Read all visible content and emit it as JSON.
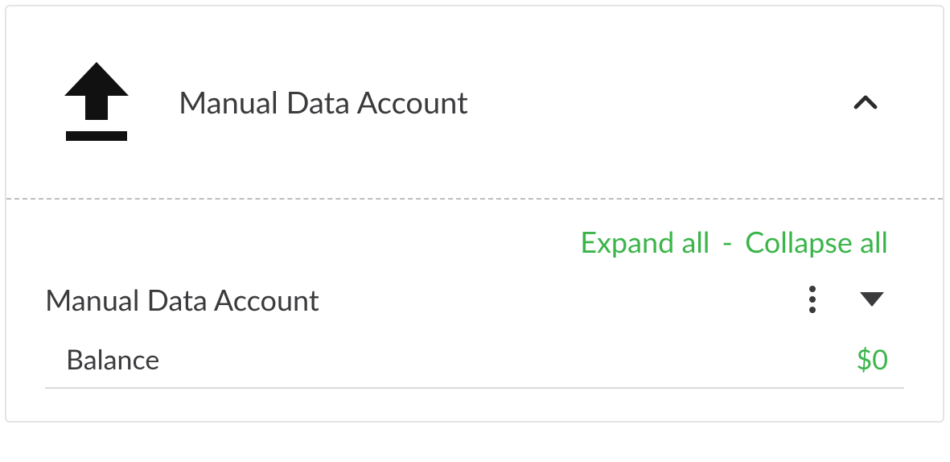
{
  "header": {
    "title": "Manual Data Account"
  },
  "controls": {
    "expand_all": "Expand all",
    "collapse_all": "Collapse all",
    "separator": "-"
  },
  "account": {
    "name": "Manual Data Account",
    "balance_label": "Balance",
    "balance_value": "$0"
  }
}
